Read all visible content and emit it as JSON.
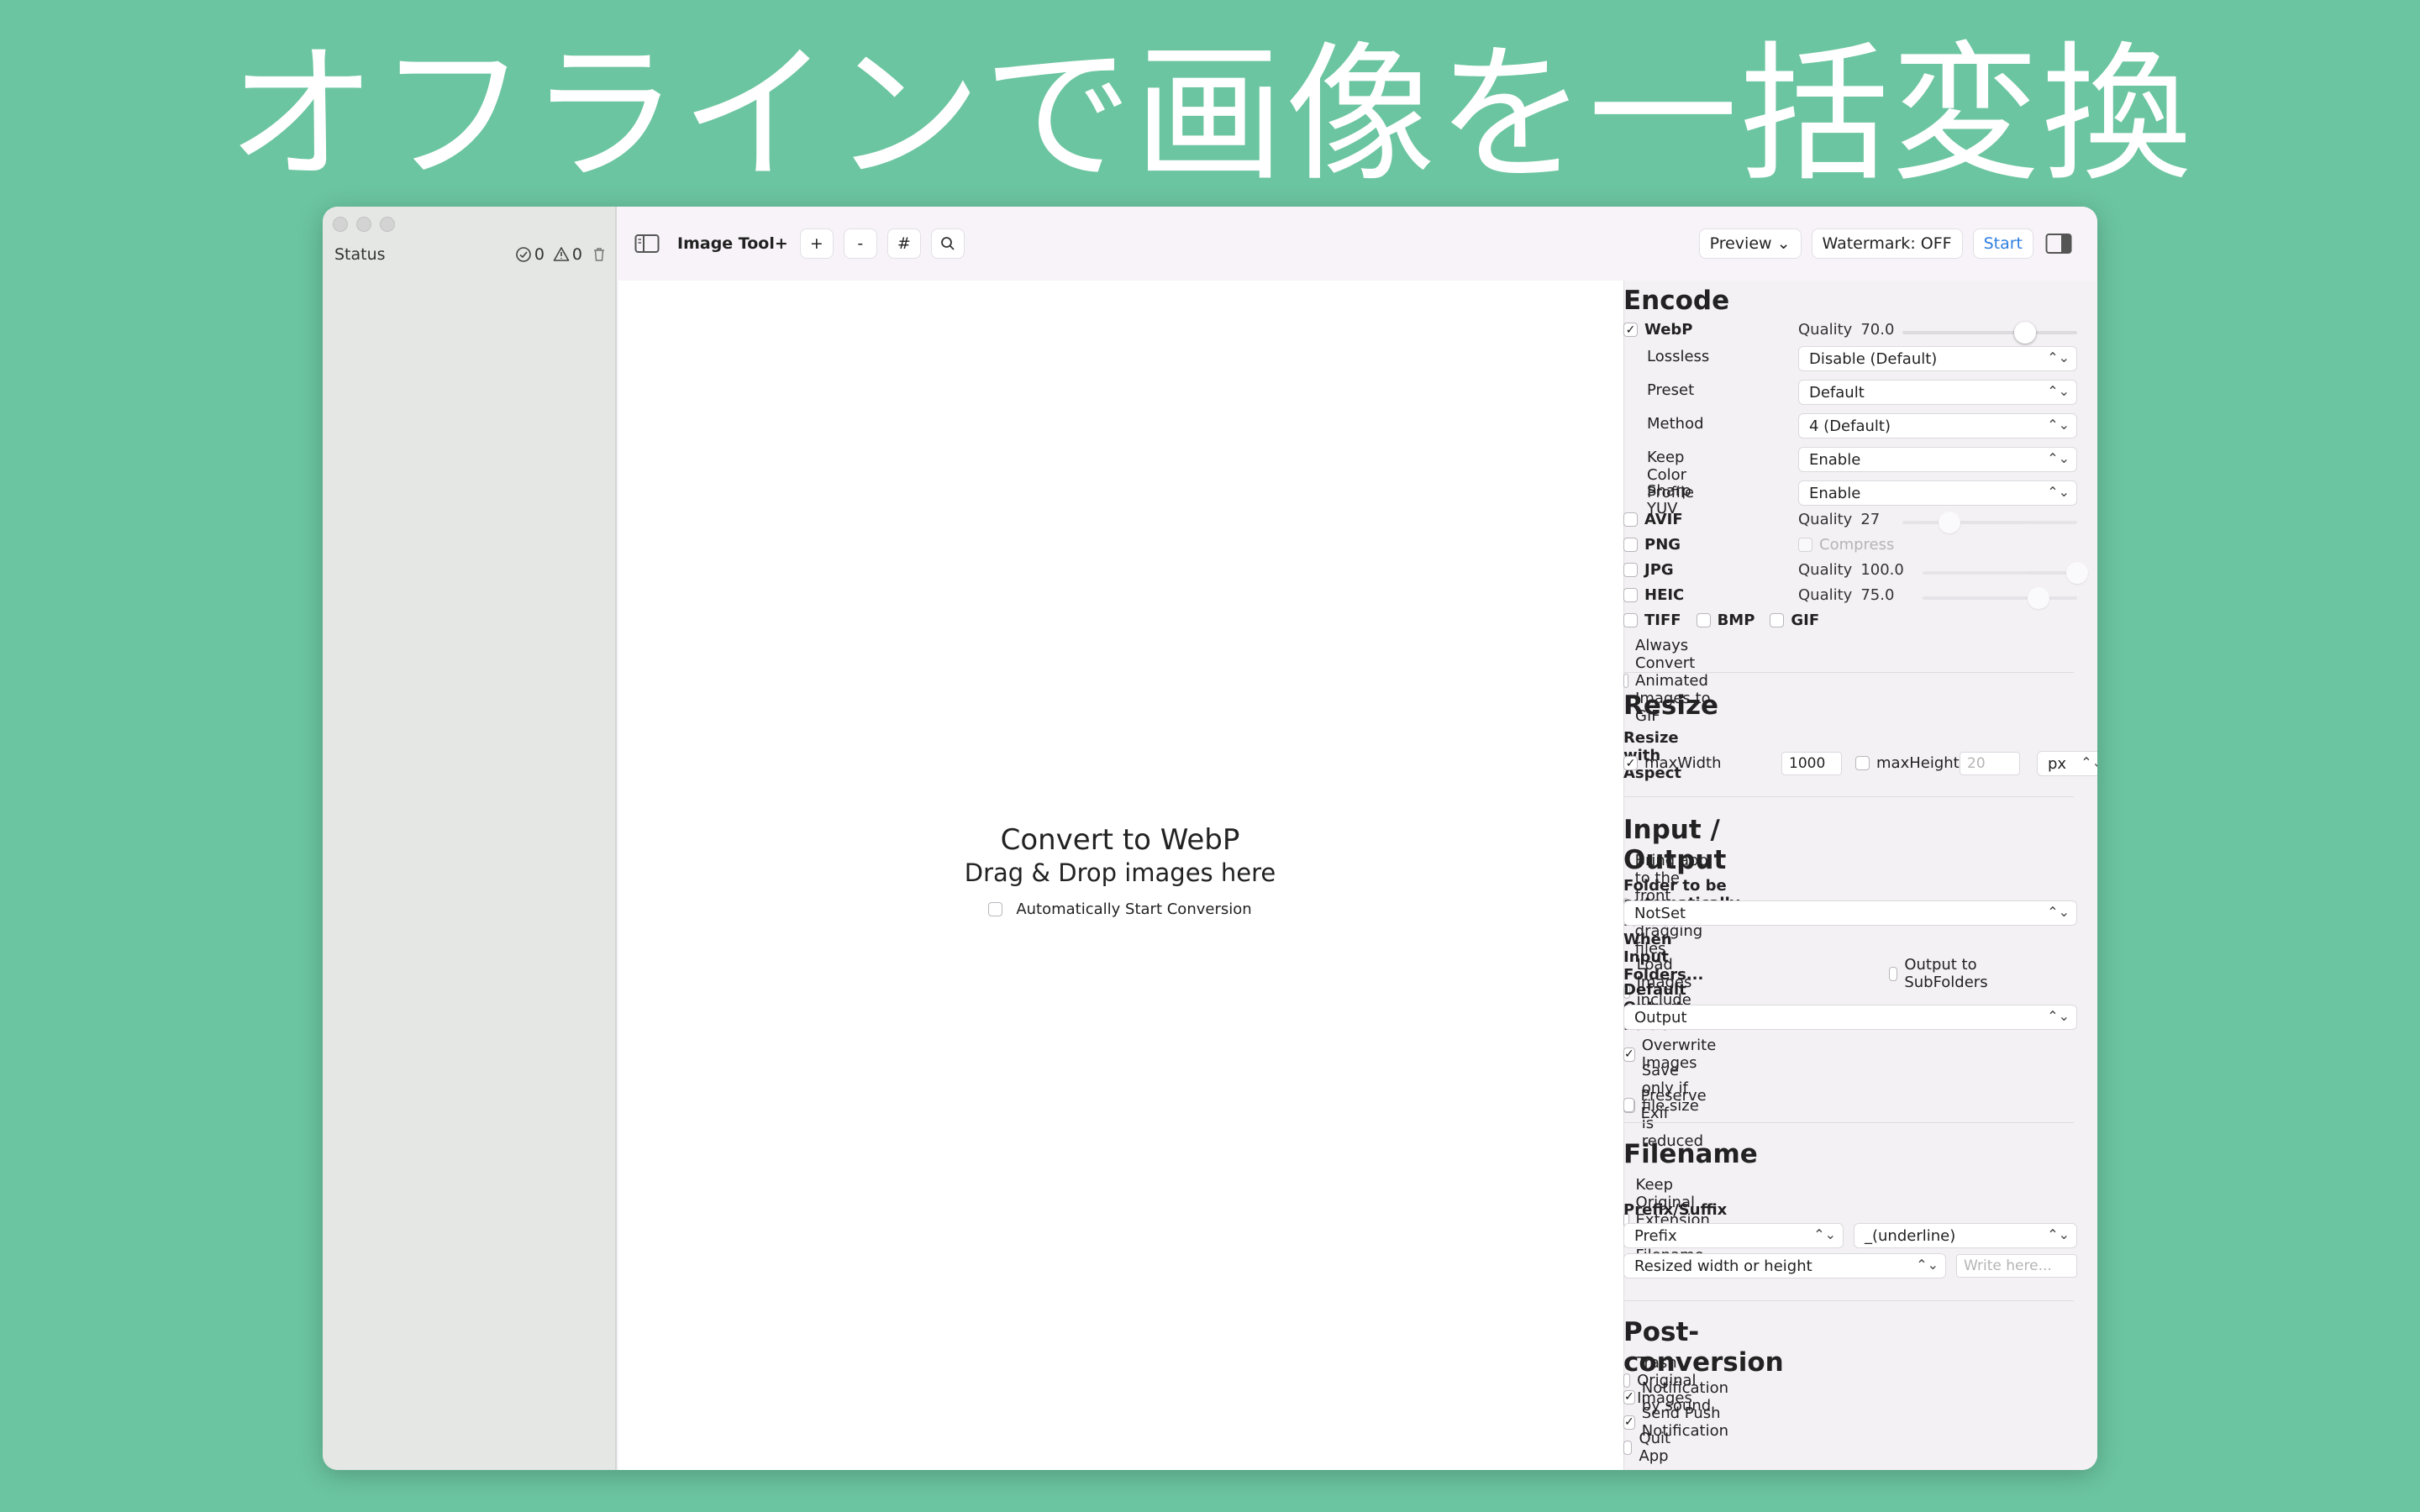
{
  "headline": "オフラインで画像を一括変換",
  "sidebar": {
    "status_label": "Status",
    "done_count": "0",
    "warning_count": "0"
  },
  "toolbar": {
    "app_name": "Image Tool+",
    "add_label": "+",
    "remove_label": "-",
    "hash_label": "#",
    "preview_label": "Preview ⌄",
    "watermark_label": "Watermark: OFF",
    "start_label": "Start"
  },
  "dropzone": {
    "title": "Convert to WebP",
    "subtitle": "Drag & Drop images here",
    "auto_start_label": "Automatically Start Conversion"
  },
  "encode": {
    "title": "Encode",
    "webp": {
      "label": "WebP",
      "checked": true,
      "quality_label": "Quality",
      "quality": "70.0",
      "quality_fraction": 0.7
    },
    "lossless": {
      "label": "Lossless",
      "value": "Disable (Default)"
    },
    "preset": {
      "label": "Preset",
      "value": "Default"
    },
    "method": {
      "label": "Method",
      "value": "4 (Default)"
    },
    "keep_color_profile": {
      "label": "Keep Color Profile",
      "value": "Enable"
    },
    "sharp_yuv": {
      "label": "Sharp YUV",
      "value": "Enable"
    },
    "avif": {
      "label": "AVIF",
      "quality_label": "Quality",
      "quality": "27",
      "quality_fraction": 0.27
    },
    "png": {
      "label": "PNG",
      "compress_label": "Compress"
    },
    "jpg": {
      "label": "JPG",
      "quality_label": "Quality",
      "quality": "100.0",
      "quality_fraction": 1.0
    },
    "heic": {
      "label": "HEIC",
      "quality_label": "Quality",
      "quality": "75.0",
      "quality_fraction": 0.75
    },
    "tiff": "TIFF",
    "bmp": "BMP",
    "gif": "GIF",
    "animated_gif_label": "Always Convert Animated Images to GIF"
  },
  "resize": {
    "title": "Resize",
    "subtitle": "Resize with Aspect",
    "max_width_label": "maxWidth",
    "max_width_value": "1000",
    "max_height_label": "maxHeight",
    "max_height_value": "20",
    "unit": "px"
  },
  "io": {
    "title": "Input / Output",
    "bring_front_label": "Bring app to the front when dragging files",
    "auto_folder_label": "Folder to be automatically loaded",
    "auto_folder_value": "NotSet",
    "when_input_label": "When Input Folders...",
    "load_subfolders_label": "Load Images include SubFolders",
    "output_subfolders_label": "Output to SubFolders",
    "default_output_label": "Default Output Folder",
    "default_output_value": "Output",
    "overwrite_label": "Overwrite Images",
    "save_reduced_label": "Save only if file size is reduced",
    "preserve_exif_label": "Preserve Exif"
  },
  "filename": {
    "title": "Filename",
    "keep_ext_label": "Keep Original Extension at Filename",
    "prefix_suffix_label": "Prefix/Suffix",
    "prefix_value": "Prefix",
    "separator_value": "_(underline)",
    "resize_value": "Resized width or height",
    "write_placeholder": "Write here..."
  },
  "post": {
    "title": "Post-conversion",
    "trash_label": "Trash Original Images",
    "sound_label": "Notification by sound",
    "push_label": "Send Push Notification",
    "quit_label": "Quit App"
  }
}
